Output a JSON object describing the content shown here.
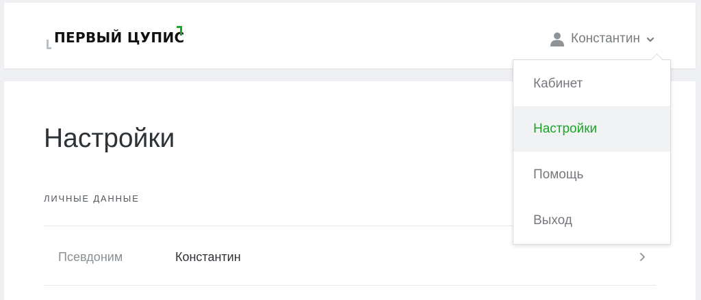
{
  "header": {
    "logo_text": "ПЕРВЫЙ ЦУПИС",
    "user": {
      "name": "Константин",
      "icon": "user-icon",
      "chevron_icon": "chevron-down-icon"
    }
  },
  "dropdown": {
    "items": [
      {
        "label": "Кабинет",
        "active": false
      },
      {
        "label": "Настройки",
        "active": true
      },
      {
        "label": "Помощь",
        "active": false
      },
      {
        "label": "Выход",
        "active": false
      }
    ]
  },
  "main": {
    "title": "Настройки",
    "section_title": "ЛИЧНЫЕ ДАННЫЕ",
    "fields": [
      {
        "label": "Псевдоним",
        "value": "Константин",
        "icon": "chevron-right-icon"
      }
    ]
  },
  "colors": {
    "accent": "#1aa528",
    "text_primary": "#2d3237",
    "text_muted": "#75797d",
    "background": "#eef0f3"
  }
}
